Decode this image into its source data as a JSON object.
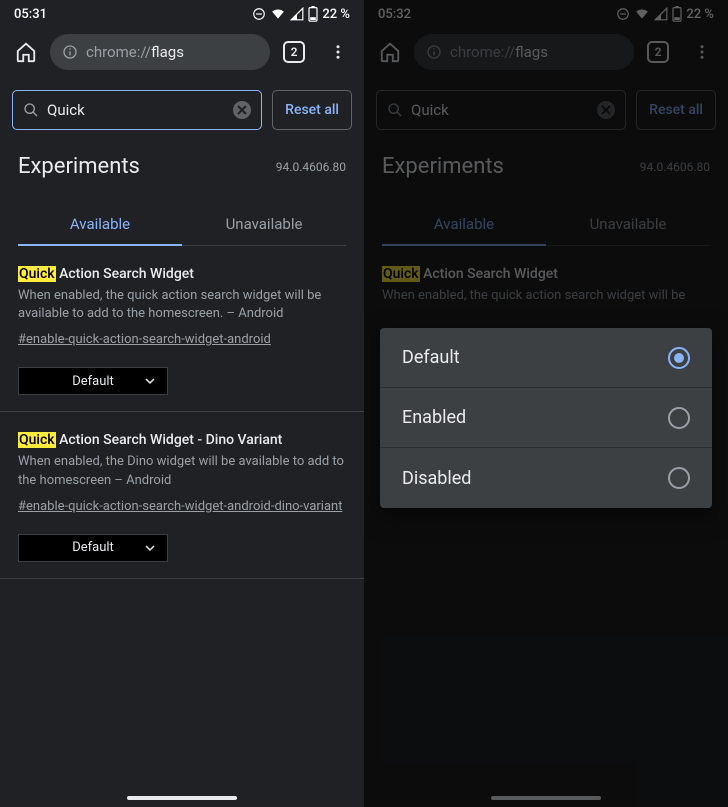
{
  "left": {
    "status": {
      "time": "05:31",
      "battery": "22 %"
    },
    "url": {
      "prefix": "chrome://",
      "path": "flags"
    },
    "tabs_count": "2",
    "search_value": "Quick",
    "reset_label": "Reset all",
    "page_title": "Experiments",
    "version": "94.0.4606.80",
    "tab_available": "Available",
    "tab_unavailable": "Unavailable",
    "flags": [
      {
        "mark": "Quick",
        "title_rest": " Action Search Widget",
        "desc": "When enabled, the quick action search widget will be available to add to the homescreen. – Android",
        "anchor": "#enable-quick-action-search-widget-android",
        "value": "Default"
      },
      {
        "mark": "Quick",
        "title_rest": " Action Search Widget - Dino Variant",
        "desc": "When enabled, the Dino widget will be available to add to the homescreen – Android",
        "anchor": "#enable-quick-action-search-widget-android-dino-variant",
        "value": "Default"
      }
    ]
  },
  "right": {
    "status": {
      "time": "05:32",
      "battery": "22 %"
    },
    "url": {
      "prefix": "chrome://",
      "path": "flags"
    },
    "tabs_count": "2",
    "search_value": "Quick",
    "reset_label": "Reset all",
    "page_title": "Experiments",
    "version": "94.0.4606.80",
    "tab_available": "Available",
    "tab_unavailable": "Unavailable",
    "flag": {
      "mark": "Quick",
      "title_rest": " Action Search Widget",
      "desc": "When enabled, the quick action search widget will be",
      "value": "Default"
    },
    "options": [
      "Default",
      "Enabled",
      "Disabled"
    ],
    "selected_index": 0
  }
}
